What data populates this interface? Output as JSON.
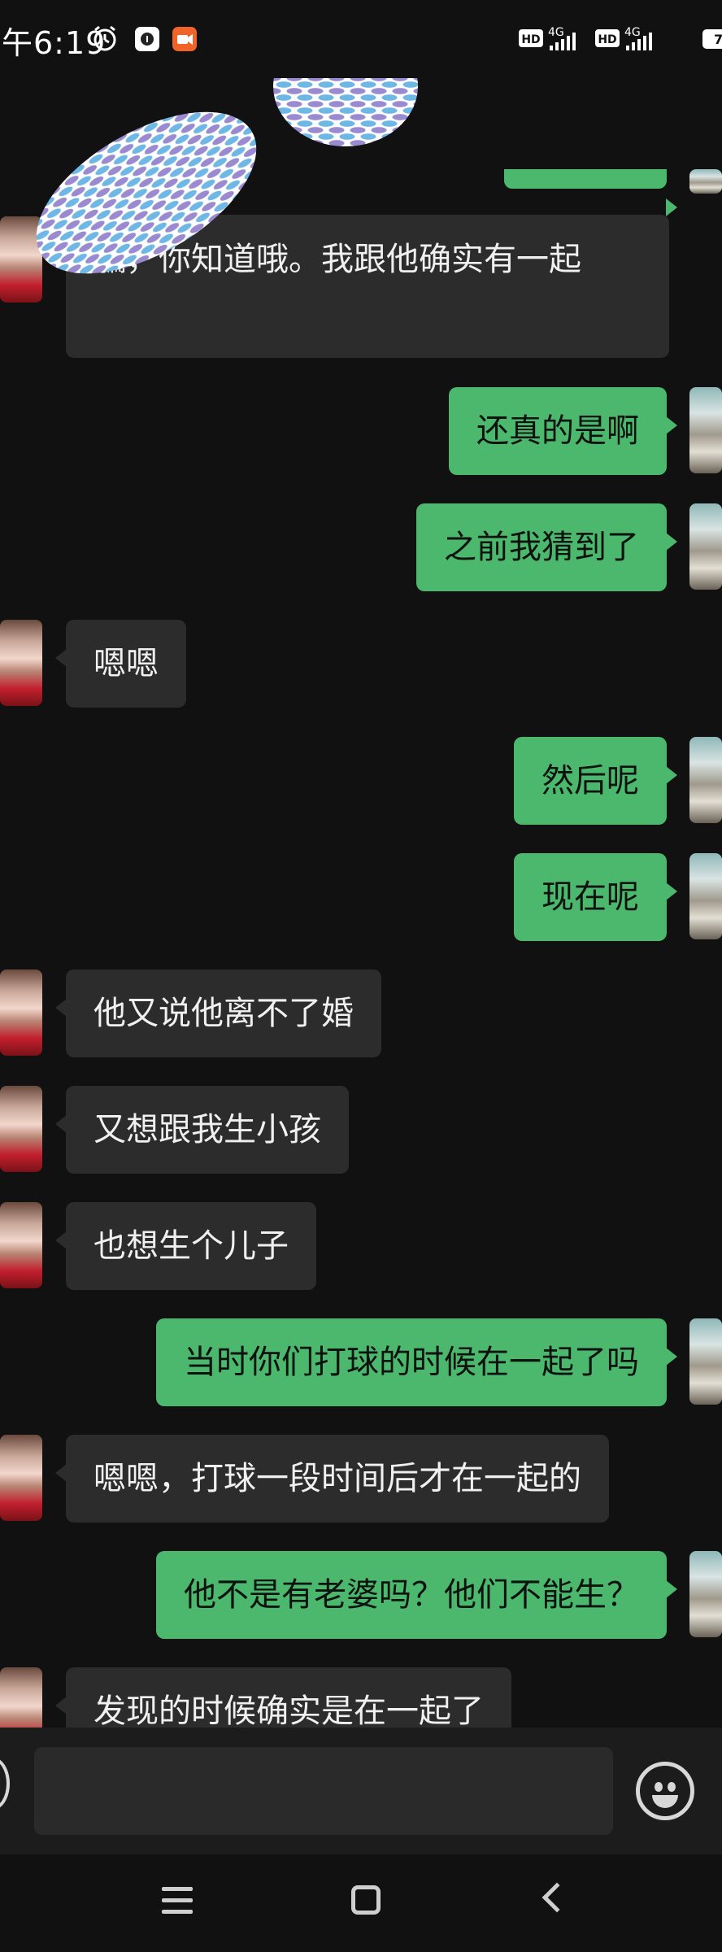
{
  "status_bar": {
    "time": "午6:19",
    "icons": [
      "alarm-icon",
      "app-notification-icon",
      "screen-record-icon"
    ],
    "signal_labels": [
      "HD",
      "4G",
      "HD",
      "4G"
    ],
    "battery_text": "7"
  },
  "messages": [
    {
      "side": "right",
      "text": "",
      "partial": true
    },
    {
      "side": "left",
      "text": "騙，你知道哦。我跟他确实有一起"
    },
    {
      "side": "right",
      "text": "还真的是啊"
    },
    {
      "side": "right",
      "text": "之前我猜到了"
    },
    {
      "side": "left",
      "text": "嗯嗯"
    },
    {
      "side": "right",
      "text": "然后呢"
    },
    {
      "side": "right",
      "text": "现在呢"
    },
    {
      "side": "left",
      "text": "他又说他离不了婚"
    },
    {
      "side": "left",
      "text": "又想跟我生小孩"
    },
    {
      "side": "left",
      "text": "也想生个儿子"
    },
    {
      "side": "right",
      "text": "当时你们打球的时候在一起了吗"
    },
    {
      "side": "left",
      "text": "嗯嗯，打球一段时间后才在一起的"
    },
    {
      "side": "right",
      "text": "他不是有老婆吗？他们不能生？"
    },
    {
      "side": "left",
      "text": "发现的时候确实是在一起了"
    }
  ],
  "input": {
    "value": "",
    "placeholder": ""
  },
  "colors": {
    "background": "#111111",
    "bubble_sent": "#4bb86d",
    "bubble_received": "#2c2c2c"
  }
}
